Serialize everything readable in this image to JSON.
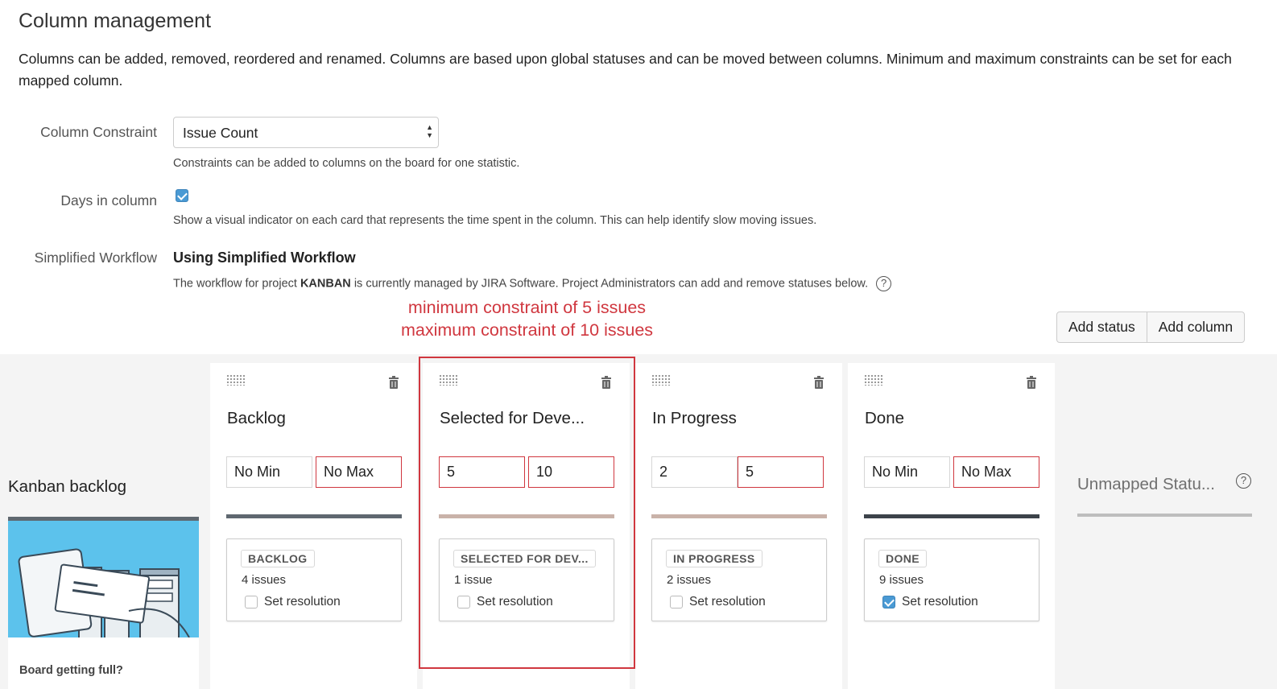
{
  "header": {
    "title": "Column management",
    "description": "Columns can be added, removed, reordered and renamed. Columns are based upon global statuses and can be moved between columns. Minimum and maximum constraints can be set for each mapped column."
  },
  "settings": {
    "column_constraint": {
      "label": "Column Constraint",
      "selected": "Issue Count",
      "help": "Constraints can be added to columns on the board for one statistic."
    },
    "days_in_column": {
      "label": "Days in column",
      "checked": true,
      "help": "Show a visual indicator on each card that represents the time spent in the column. This can help identify slow moving issues."
    },
    "simplified_workflow": {
      "label": "Simplified Workflow",
      "value": "Using Simplified Workflow",
      "help_prefix": "The workflow for project ",
      "help_project": "KANBAN",
      "help_suffix": " is currently managed by JIRA Software. Project Administrators can add and remove statuses below.",
      "help_icon": "?"
    }
  },
  "annotation": {
    "line1": "minimum constraint of 5 issues",
    "line2": "maximum constraint of 10 issues",
    "color": "#d0373f"
  },
  "actions": {
    "add_status": "Add status",
    "add_column": "Add column"
  },
  "kanban_backlog": {
    "title": "Kanban backlog",
    "panel_text": "Board getting full?"
  },
  "columns": [
    {
      "name": "Backlog",
      "min": "No Min",
      "max": "No Max",
      "bar_color": "#5f6870",
      "status": "BACKLOG",
      "issues": "4 issues",
      "resolution_label": "Set resolution",
      "resolution_checked": false
    },
    {
      "name": "Selected for Deve...",
      "min": "5",
      "max": "10",
      "bar_color": "#c9b2a9",
      "status": "SELECTED FOR DEV...",
      "issues": "1 issue",
      "resolution_label": "Set resolution",
      "resolution_checked": false
    },
    {
      "name": "In Progress",
      "min": "2",
      "max": "5",
      "bar_color": "#c9b2a9",
      "status": "IN PROGRESS",
      "issues": "2 issues",
      "resolution_label": "Set resolution",
      "resolution_checked": false
    },
    {
      "name": "Done",
      "min": "No Min",
      "max": "No Max",
      "bar_color": "#3c434a",
      "status": "DONE",
      "issues": "9 issues",
      "resolution_label": "Set resolution",
      "resolution_checked": true
    }
  ],
  "unmapped": {
    "title": "Unmapped Statu...",
    "help_icon": "?"
  }
}
